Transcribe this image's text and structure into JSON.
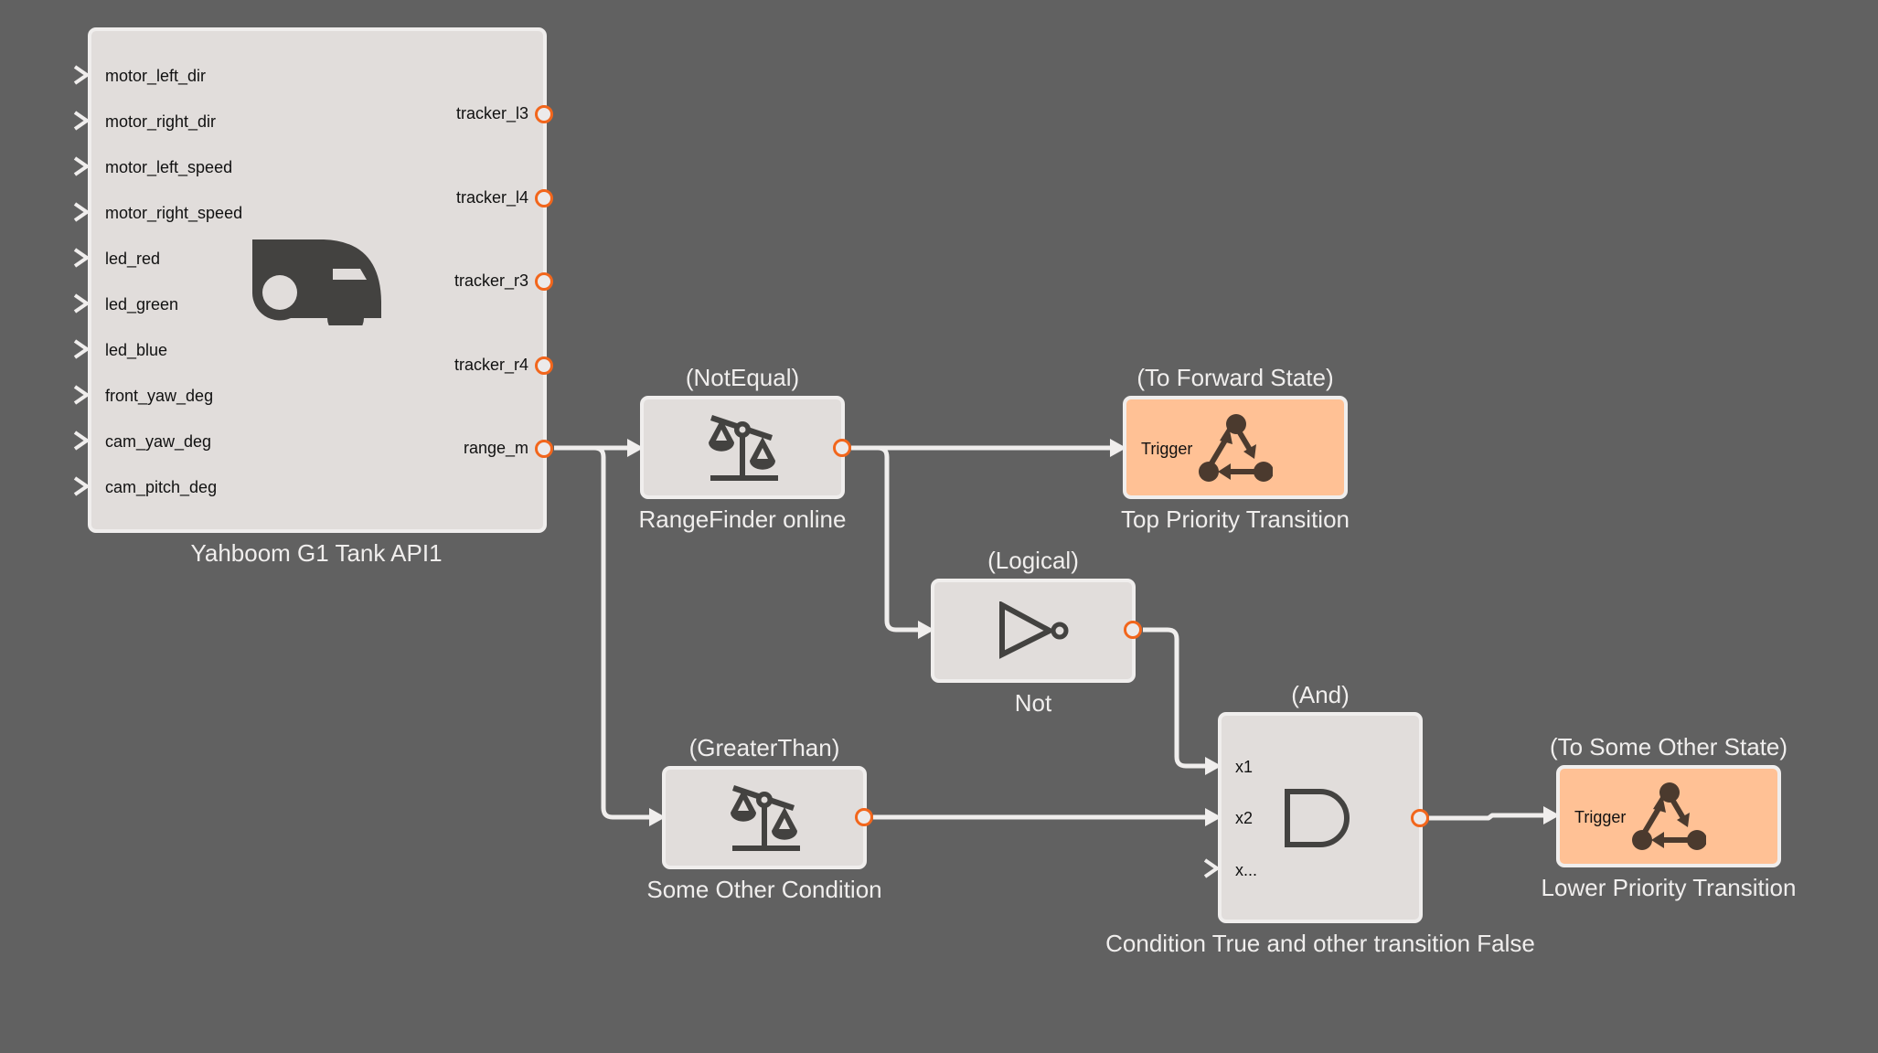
{
  "colors": {
    "background": "#616161",
    "block_fill": "#e1dddb",
    "trigger_fill": "#ffc195",
    "port_ring": "#f2661c",
    "wire": "#f0eeed",
    "icon": "#434240"
  },
  "main_block": {
    "name": "Yahboom G1 Tank API1",
    "icon": "truck-icon",
    "inputs": [
      "motor_left_dir",
      "motor_right_dir",
      "motor_left_speed",
      "motor_right_speed",
      "led_red",
      "led_green",
      "led_blue",
      "front_yaw_deg",
      "cam_yaw_deg",
      "cam_pitch_deg"
    ],
    "outputs": [
      "tracker_l3",
      "tracker_l4",
      "tracker_r3",
      "tracker_r4",
      "range_m"
    ]
  },
  "blocks": {
    "notequal": {
      "type": "(NotEqual)",
      "name": "RangeFinder online",
      "icon": "scale-icon"
    },
    "forward": {
      "type": "(To Forward State)",
      "name": "Top Priority Transition",
      "port": "Trigger",
      "icon": "state-transition-icon"
    },
    "logical": {
      "type": "(Logical)",
      "name": "Not",
      "icon": "not-gate-icon"
    },
    "greaterthan": {
      "type": "(GreaterThan)",
      "name": "Some Other Condition",
      "icon": "scale-icon"
    },
    "and": {
      "type": "(And)",
      "name": "Condition True and other transition False",
      "inputs": [
        "x1",
        "x2",
        "x..."
      ],
      "icon": "and-gate-icon"
    },
    "other": {
      "type": "(To Some Other State)",
      "name": "Lower Priority Transition",
      "port": "Trigger",
      "icon": "state-transition-icon"
    }
  }
}
